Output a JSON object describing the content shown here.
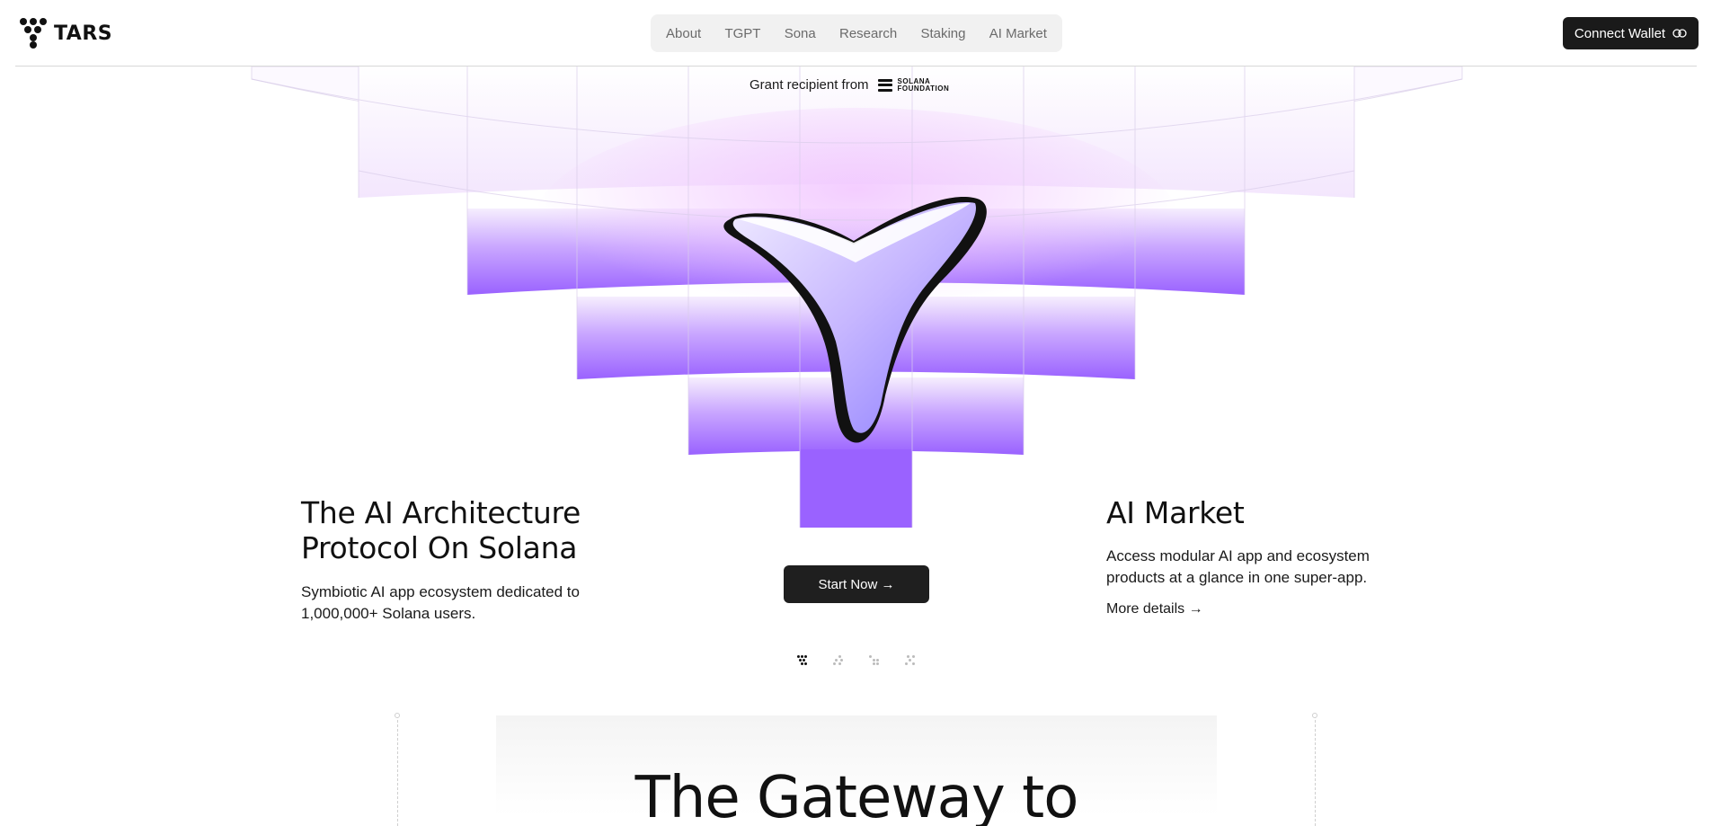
{
  "brand": {
    "name": "TARS",
    "icon": "tars-logo-icon"
  },
  "nav": {
    "items": [
      "About",
      "TGPT",
      "Sona",
      "Research",
      "Staking",
      "AI Market"
    ]
  },
  "wallet": {
    "label": "Connect Wallet",
    "icon": "link-icon"
  },
  "grant": {
    "text": "Grant recipient from",
    "logo_text": "SOLANA FOUNDATION"
  },
  "hero": {
    "title": "The AI Architecture Protocol On Solana",
    "subtitle": "Symbiotic AI app ecosystem dedicated to 1,000,000+ Solana users.",
    "cta": "Start Now →"
  },
  "feature": {
    "title": "AI Market",
    "description": "Access modular AI app and ecosystem products at a glance in one super-app.",
    "link": "More details →"
  },
  "carousel": {
    "count": 4,
    "active": 0
  },
  "section": {
    "heading": "The Gateway to"
  },
  "colors": {
    "accent": "#9b6bff",
    "dark": "#1a1a1a",
    "nav_bg": "#f1f1f1"
  }
}
